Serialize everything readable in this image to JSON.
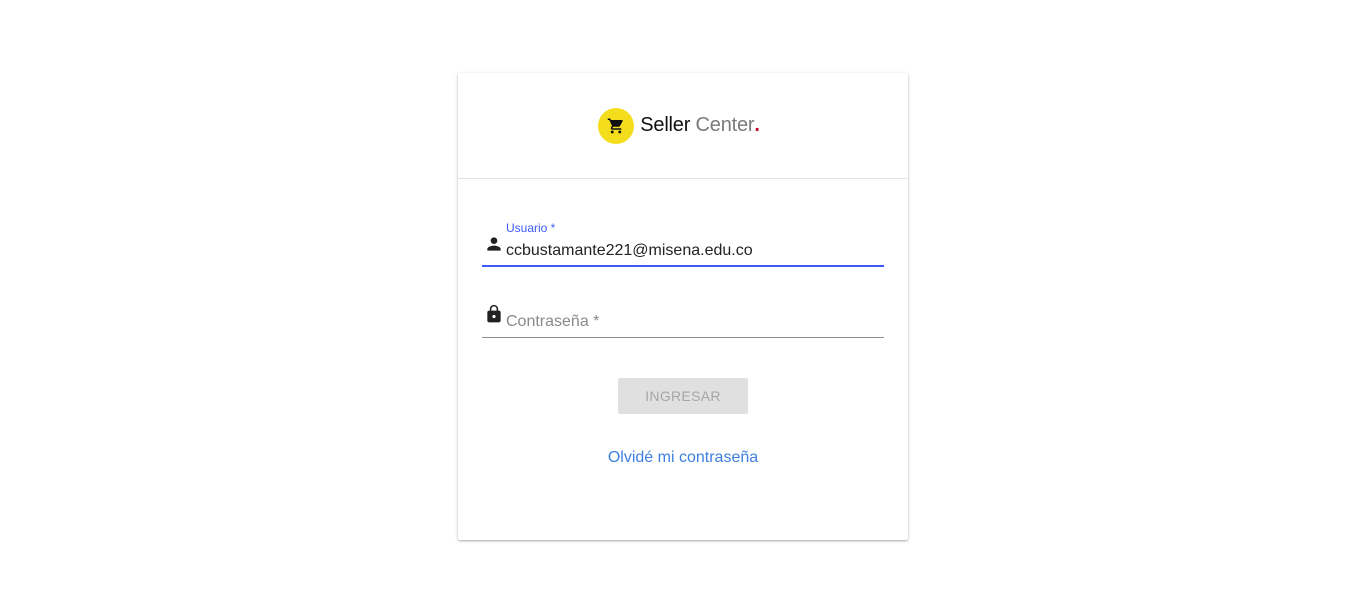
{
  "brand": {
    "seller": "Seller",
    "center": "Center",
    "dot": ".",
    "icon": "shopping-cart-icon",
    "icon_bg": "#f3dd1c",
    "dot_color": "#c8102e"
  },
  "form": {
    "user": {
      "label": "Usuario *",
      "value": "ccbustamante221@misena.edu.co",
      "icon": "person-icon"
    },
    "password": {
      "placeholder": "Contraseña *",
      "value": "",
      "icon": "lock-icon"
    },
    "submit_label": "INGRESAR",
    "forgot_label": "Olvidé mi contraseña"
  },
  "colors": {
    "accent": "#3d5afe",
    "link": "#3f7fe0",
    "button_disabled_bg": "#e0e0e0",
    "button_disabled_text": "#a6a6a6"
  }
}
